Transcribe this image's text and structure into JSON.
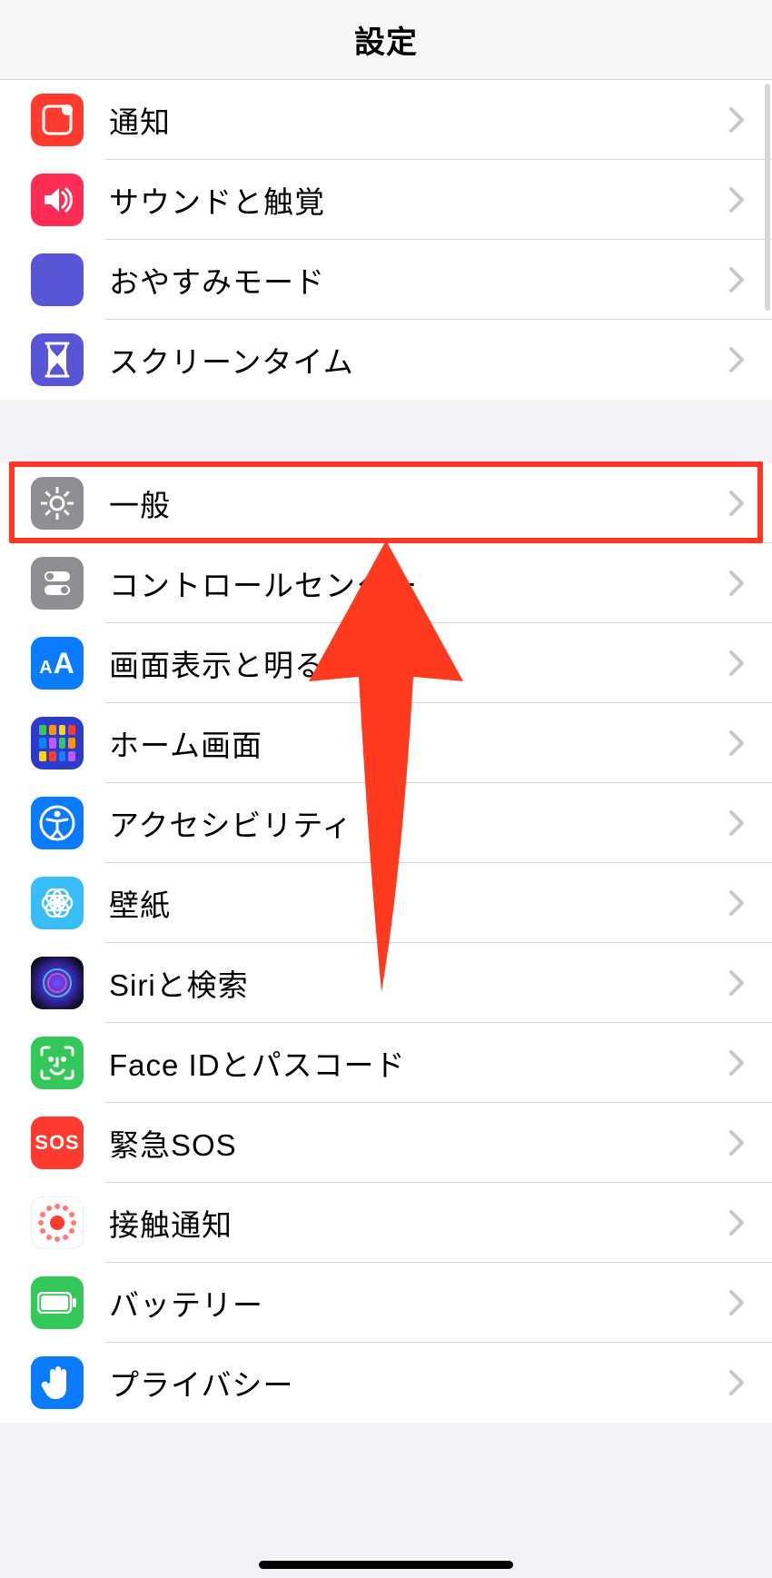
{
  "header": {
    "title": "設定"
  },
  "highlightedKey": "general",
  "groups": [
    {
      "items": [
        {
          "key": "notifications",
          "label": "通知",
          "icon": "notifications-icon",
          "bg": "#ff3b30"
        },
        {
          "key": "sounds",
          "label": "サウンドと触覚",
          "icon": "sounds-icon",
          "bg": "#ff2d55"
        },
        {
          "key": "dnd",
          "label": "おやすみモード",
          "icon": "moon-icon",
          "bg": "#5856d6"
        },
        {
          "key": "screentime",
          "label": "スクリーンタイム",
          "icon": "hourglass-icon",
          "bg": "#5856d6"
        }
      ]
    },
    {
      "items": [
        {
          "key": "general",
          "label": "一般",
          "icon": "gear-icon",
          "bg": "#8e8e93"
        },
        {
          "key": "control-center",
          "label": "コントロールセンター",
          "icon": "toggles-icon",
          "bg": "#8e8e93"
        },
        {
          "key": "display",
          "label": "画面表示と明るさ",
          "icon": "textsize-icon",
          "bg": "#0a7aff"
        },
        {
          "key": "homescreen",
          "label": "ホーム画面",
          "icon": "home-grid-icon",
          "bg": "#2a3cc9"
        },
        {
          "key": "accessibility",
          "label": "アクセシビリティ",
          "icon": "accessibility-icon",
          "bg": "#0a7aff"
        },
        {
          "key": "wallpaper",
          "label": "壁紙",
          "icon": "flower-icon",
          "bg": "#38bdf8"
        },
        {
          "key": "siri",
          "label": "Siriと検索",
          "icon": "siri-icon",
          "bg": "#000000"
        },
        {
          "key": "faceid",
          "label": "Face IDとパスコード",
          "icon": "face-id-icon",
          "bg": "#34c759"
        },
        {
          "key": "sos",
          "label": "緊急SOS",
          "icon": "sos-icon",
          "bg": "#ff3b30",
          "text": "SOS"
        },
        {
          "key": "exposure",
          "label": "接触通知",
          "icon": "exposure-icon",
          "bg": "#ffffff"
        },
        {
          "key": "battery",
          "label": "バッテリー",
          "icon": "battery-icon",
          "bg": "#34c759"
        },
        {
          "key": "privacy",
          "label": "プライバシー",
          "icon": "hand-icon",
          "bg": "#0a7aff"
        }
      ]
    }
  ]
}
